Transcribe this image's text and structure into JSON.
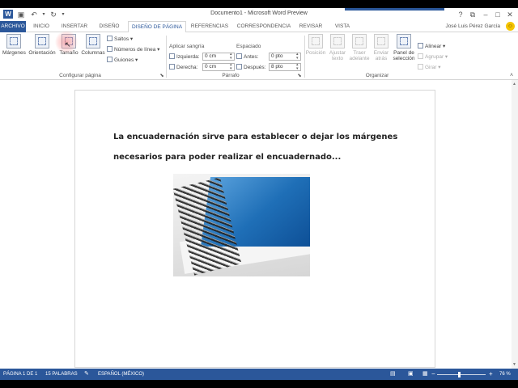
{
  "window": {
    "title": "Documento1 - Microsoft Word Preview",
    "user": "José Luis Pérez García",
    "help_label": "?"
  },
  "tabs": [
    "ARCHIVO",
    "INICIO",
    "INSERTAR",
    "DISEÑO",
    "DISEÑO DE PÁGINA",
    "REFERENCIAS",
    "CORRESPONDENCIA",
    "REVISAR",
    "VISTA"
  ],
  "active_tab": "DISEÑO DE PÁGINA",
  "ribbon": {
    "configurar_pagina": {
      "label": "Configurar página",
      "margenes": "Márgenes",
      "orientacion": "Orientación",
      "tamano": "Tamaño",
      "columnas": "Columnas",
      "saltos": "Saltos",
      "numeros_linea": "Números de línea",
      "guiones": "Guiones"
    },
    "parrafo": {
      "label": "Párrafo",
      "aplicar_sangria": "Aplicar sangría",
      "izquierda_label": "Izquierda:",
      "izquierda_value": "0 cm",
      "derecha_label": "Derecha:",
      "derecha_value": "0 cm",
      "espaciado": "Espaciado",
      "antes_label": "Antes:",
      "antes_value": "0 pto",
      "despues_label": "Después:",
      "despues_value": "8 pto"
    },
    "organizar": {
      "label": "Organizar",
      "posicion": "Posición",
      "ajustar": [
        "Ajustar",
        "texto"
      ],
      "traer": [
        "Traer",
        "adelante"
      ],
      "enviar": [
        "Enviar",
        "atrás"
      ],
      "panel": [
        "Panel de",
        "selección"
      ],
      "alinear": "Alinear",
      "agrupar": "Agrupar",
      "girar": "Girar"
    }
  },
  "document": {
    "text": "La encuadernación sirve para establecer o dejar los márgenes necesarios para poder realizar el encuadernado..."
  },
  "status": {
    "page": "PÁGINA 1 DE 1",
    "words": "15 PALABRAS",
    "language": "ESPAÑOL (MÉXICO)",
    "zoom": "76 %",
    "minus": "−",
    "plus": "+"
  }
}
